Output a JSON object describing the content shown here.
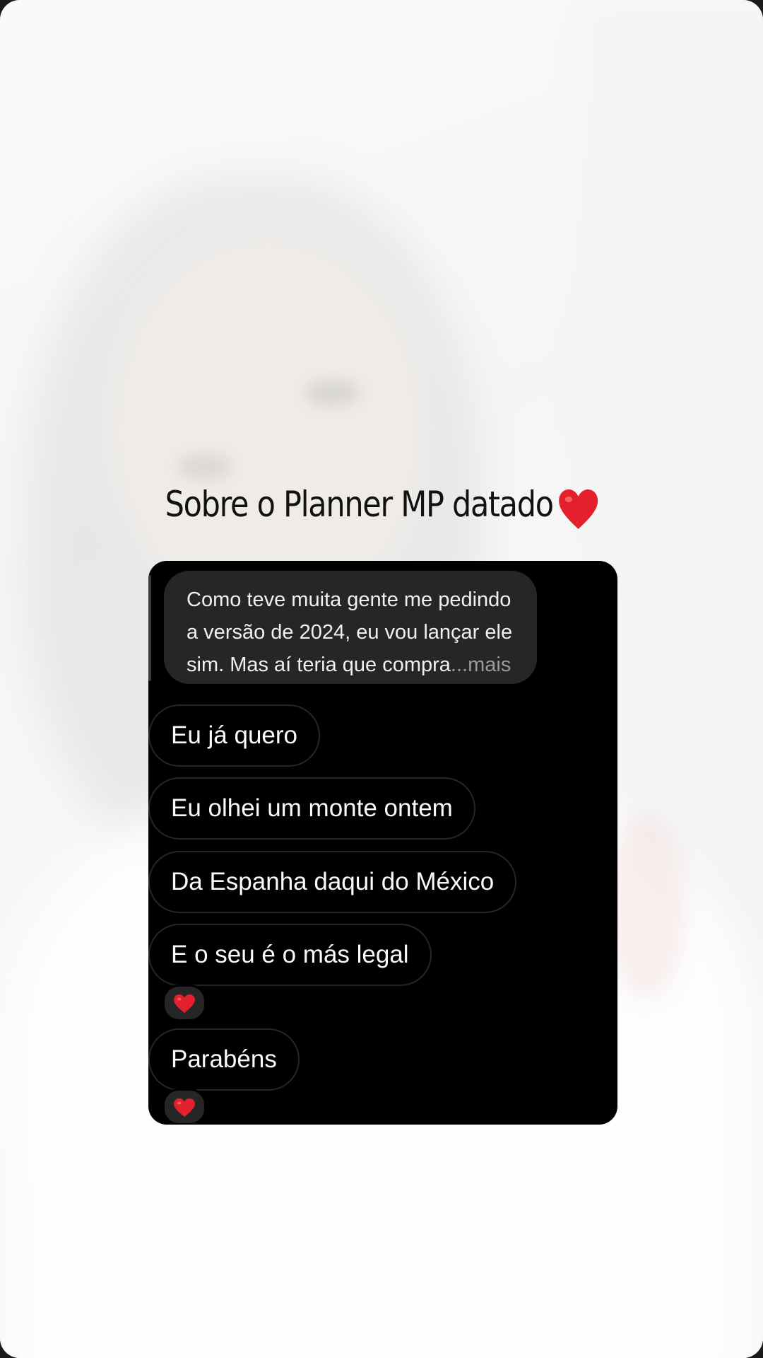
{
  "story": {
    "caption": "Sobre o Planner MP datado",
    "caption_emoji": "heart",
    "accent_heart_color": "#e3202b"
  },
  "chat": {
    "quoted_message": {
      "text": "Como teve muita gente me pedindo a versão de 2024, eu vou lançar ele sim. Mas aí teria que compra",
      "more_label": "...mais"
    },
    "messages": [
      {
        "text": "Eu já quero",
        "reaction": null
      },
      {
        "text": "Eu olhei um monte ontem",
        "reaction": null
      },
      {
        "text": "Da Espanha daqui do México",
        "reaction": null
      },
      {
        "text": "E o seu é o más legal",
        "reaction": "heart"
      },
      {
        "text": "Parabéns",
        "reaction": "heart"
      }
    ]
  }
}
